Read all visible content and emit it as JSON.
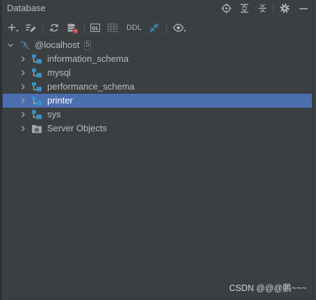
{
  "header": {
    "title": "Database",
    "action_icons": [
      "crosshair-icon",
      "expand-all-icon",
      "collapse-all-icon",
      "gear-icon",
      "minimize-icon"
    ]
  },
  "toolbar": {
    "items": [
      {
        "icon": "plus-icon",
        "has_dropdown": true
      },
      {
        "icon": "properties-icon"
      },
      {
        "icon": "refresh-icon"
      },
      {
        "icon": "database-stop-icon"
      },
      {
        "icon": "sql-console-icon"
      },
      {
        "icon": "table-grid-icon"
      },
      {
        "icon": "ddl-icon"
      },
      {
        "icon": "jump-to-source-icon"
      },
      {
        "icon": "eye-icon",
        "has_dropdown": true
      }
    ],
    "console_icon_text": "QL",
    "ddl_label": "DDL"
  },
  "tree": {
    "root": {
      "label": "@localhost",
      "badge": "5",
      "icon": "mysql-connection-icon",
      "expanded": true
    },
    "children": [
      {
        "label": "information_schema",
        "icon": "schema-icon",
        "expanded": false
      },
      {
        "label": "mysql",
        "icon": "schema-icon",
        "expanded": false
      },
      {
        "label": "performance_schema",
        "icon": "schema-icon",
        "expanded": false
      },
      {
        "label": "printer",
        "icon": "schema-icon",
        "expanded": false
      },
      {
        "label": "sys",
        "icon": "schema-icon",
        "expanded": false
      },
      {
        "label": "Server Objects",
        "icon": "folder-icon",
        "expanded": false
      }
    ],
    "selected_index": 3
  },
  "watermark": "CSDN @@@鹏~~~",
  "colors": {
    "panel_bg": "#3c3f41",
    "selection_bg": "#4b6eaf",
    "text": "#bbbbbb",
    "icon": "#afb1b3",
    "accent_blue": "#3592c4",
    "stop_red": "#db5c5c"
  }
}
